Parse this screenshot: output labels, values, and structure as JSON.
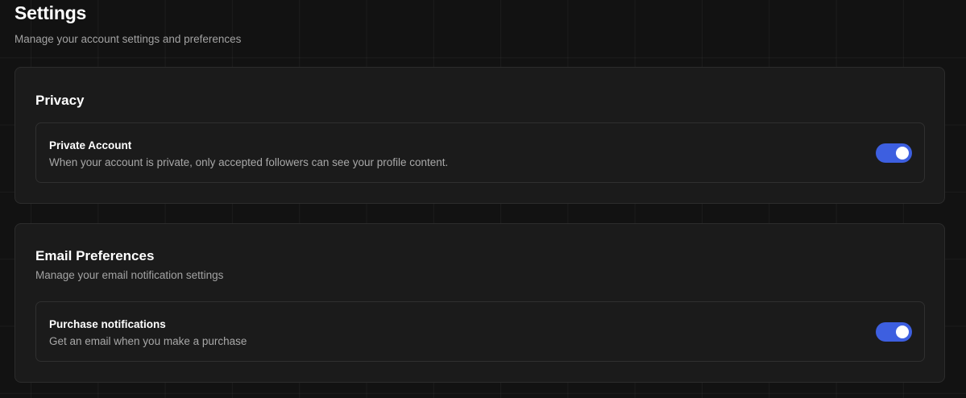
{
  "header": {
    "title": "Settings",
    "subtitle": "Manage your account settings and preferences"
  },
  "privacy": {
    "title": "Privacy",
    "items": [
      {
        "label": "Private Account",
        "description": "When your account is private, only accepted followers can see your profile content.",
        "enabled": true
      }
    ]
  },
  "email": {
    "title": "Email Preferences",
    "description": "Manage your email notification settings",
    "items": [
      {
        "label": "Purchase notifications",
        "description": "Get an email when you make a purchase",
        "enabled": true
      }
    ]
  },
  "colors": {
    "accent": "#3d5fe0",
    "background": "#121212",
    "card": "#1b1b1b"
  }
}
